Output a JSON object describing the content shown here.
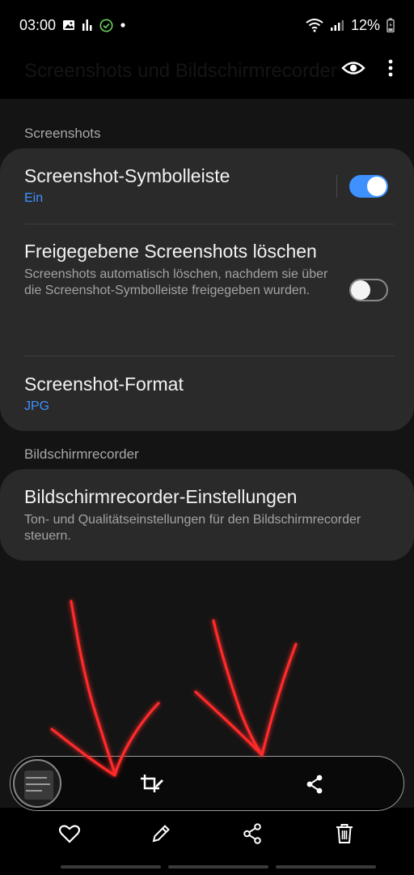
{
  "status_bar": {
    "time": "03:00",
    "battery_text": "12%",
    "icons": [
      "gallery-icon",
      "chart-icon",
      "check-circle-icon",
      "dot-icon",
      "wifi-icon",
      "signal-icon",
      "battery-icon"
    ]
  },
  "app_bar": {
    "title": "Screenshots und Bildschirmrecorder",
    "actions": [
      "eye-icon",
      "more-vert-icon"
    ]
  },
  "sections": {
    "screenshots": {
      "title": "Screenshots",
      "toolbar": {
        "title": "Screenshot-Symbolleiste",
        "status": "Ein",
        "enabled": true
      },
      "delete_shared": {
        "title": "Freigegebene Screenshots löschen",
        "description": "Screenshots automatisch löschen, nachdem sie über die Screenshot-Symbolleiste freigegeben wurden.",
        "enabled": false
      },
      "format": {
        "title": "Screenshot-Format",
        "value": "JPG"
      }
    },
    "recorder": {
      "title": "Bildschirmrecorder",
      "settings": {
        "title": "Bildschirmrecorder-Einstellungen",
        "description": "Ton- und Qualitätseinstellungen für den Bildschirmrecorder steuern."
      }
    }
  },
  "floating_toolbar": {
    "buttons": [
      "crop-edit-icon",
      "share-icon"
    ]
  },
  "bottom_actions": [
    "heart-icon",
    "pencil-icon",
    "share-icon",
    "trash-icon"
  ],
  "colors": {
    "accent": "#3e91ff",
    "background": "#000000",
    "card": "#2a2a2a",
    "annotation": "#ff2a2a"
  }
}
